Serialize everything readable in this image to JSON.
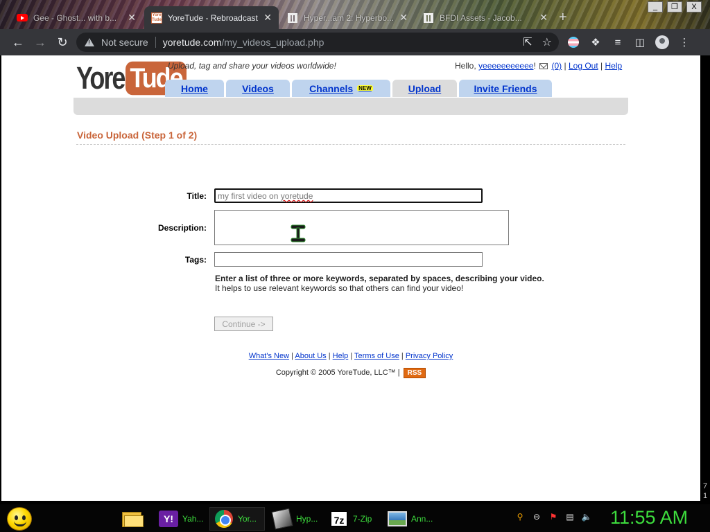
{
  "browser": {
    "tabs": [
      {
        "title": "Gee - Ghost... with b...",
        "icon": "youtube-icon",
        "active": false
      },
      {
        "title": "YoreTude - Rebroadcast",
        "icon": "yoretude-icon",
        "active": true
      },
      {
        "title": "Hyper...am 2: Hyperbo...",
        "icon": "archive-icon",
        "active": false
      },
      {
        "title": "BFDI Assets - Jacob...",
        "icon": "archive-icon",
        "active": false
      }
    ],
    "new_tab": "+",
    "window_controls": [
      "_",
      "❐",
      "X"
    ],
    "security_label": "Not secure",
    "url_host": "yoretude.com",
    "url_path": "/my_videos_upload.php"
  },
  "site": {
    "logo_yore": "Yore",
    "logo_tude": "Tude",
    "tagline": "Upload, tag and share your videos worldwide!",
    "greeting": "Hello,",
    "username": "yeeeeeeeeeee",
    "bang": "!",
    "inbox_count": "(0)",
    "logout": "Log Out",
    "help": "Help",
    "sep": "|",
    "nav": {
      "home": "Home",
      "videos": "Videos",
      "channels": "Channels",
      "new_badge": "NEW",
      "upload": "Upload",
      "invite": "Invite Friends"
    }
  },
  "form": {
    "heading": "Video Upload (Step 1 of 2)",
    "title_label": "Title:",
    "title_value_prefix": "my first video on ",
    "title_value_misspelled": "yoretude",
    "description_label": "Description:",
    "tags_label": "Tags:",
    "hint_bold": "Enter a list of three or more keywords, separated by spaces, describing your video.",
    "hint": "It helps to use relevant keywords so that others can find your video!",
    "continue_label": "Continue ->"
  },
  "footer": {
    "whats_new": "What's New",
    "about": "About Us",
    "help": "Help",
    "terms": "Terms of Use",
    "privacy": "Privacy Policy",
    "copyright": "Copyright © 2005 YoreTude, LLC™ |",
    "rss": "RSS"
  },
  "page_corner_digits": [
    "7",
    "1"
  ],
  "taskbar": {
    "apps": [
      {
        "label": "Yah...",
        "icon": "yahoo-messenger-icon"
      },
      {
        "label": "Yor...",
        "icon": "chrome-icon",
        "active": true
      },
      {
        "label": "Hyp...",
        "icon": "hypercam-icon"
      },
      {
        "label": "7-Zip",
        "icon": "7zip-icon"
      },
      {
        "label": "Ann...",
        "icon": "picture-icon"
      }
    ],
    "clock": "11:55 AM"
  }
}
